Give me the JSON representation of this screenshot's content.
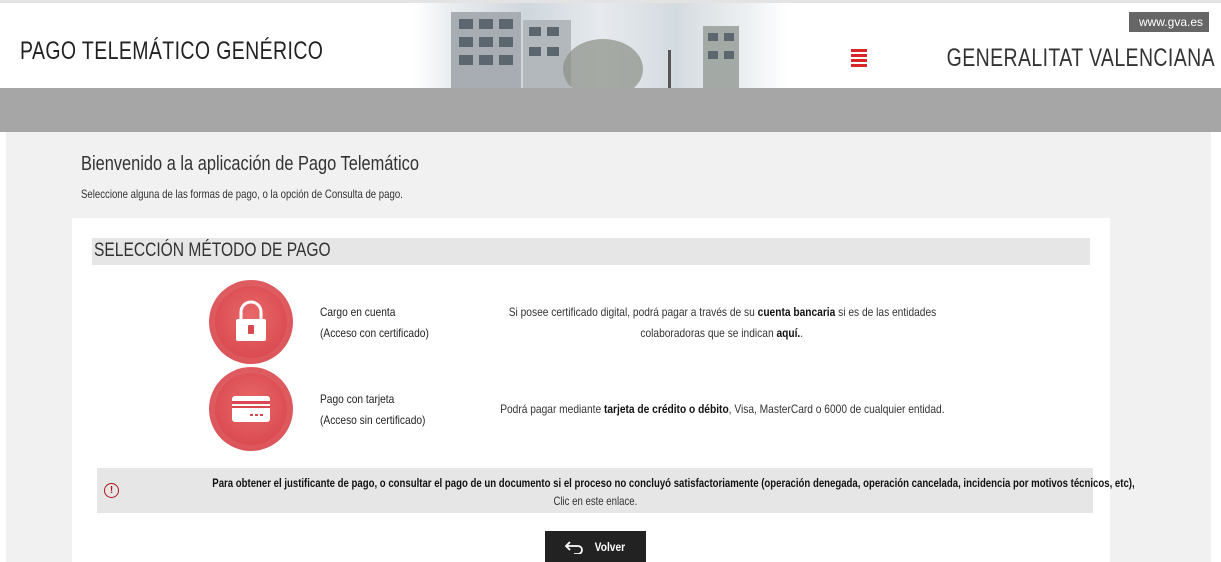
{
  "header": {
    "app_title": "PAGO TELEMÁTICO GENÉRICO",
    "gva_link": "www.gva.es",
    "org_name": "GENERALITAT VALENCIANA"
  },
  "welcome": {
    "title": "Bienvenido a la aplicación de Pago Telemático",
    "subtitle": "Seleccione alguna de las formas de pago, o la opción de Consulta de pago."
  },
  "section": {
    "title": "SELECCIÓN MÉTODO DE PAGO"
  },
  "methods": [
    {
      "icon": "padlock-icon",
      "label_line1": "Cargo en cuenta",
      "label_line2": "(Acceso con certificado)",
      "desc_pre": "Si posee certificado digital, podrá pagar a través de su ",
      "desc_bold": "cuenta bancaria",
      "desc_post": " si es de las entidades",
      "desc_line2_pre": "colaboradoras que se indican ",
      "desc_link": "aquí.",
      "desc_line2_post": "."
    },
    {
      "icon": "credit-card-icon",
      "label_line1": "Pago con tarjeta",
      "label_line2": "(Acceso sin certificado)",
      "desc_pre": "Podrá pagar mediante ",
      "desc_bold": "tarjeta de crédito o débito",
      "desc_post": ", Visa, MasterCard o 6000 de cualquier entidad."
    }
  ],
  "notice": {
    "icon": "exclamation-circle-icon",
    "text": "Para obtener el justificante de pago, o consultar el pago de un documento si el proceso no concluyó satisfactoriamente (operación denegada, operación cancelada, incidencia por motivos técnicos, etc),",
    "link": "Clic en este enlace."
  },
  "back_button": {
    "icon": "back-arrow-icon",
    "label": "Volver"
  },
  "colors": {
    "nav_bar": "#a6a6a6",
    "icon_red": "#d9484e",
    "notice_icon": "#b0151d",
    "brand_red": "#d9262b"
  }
}
